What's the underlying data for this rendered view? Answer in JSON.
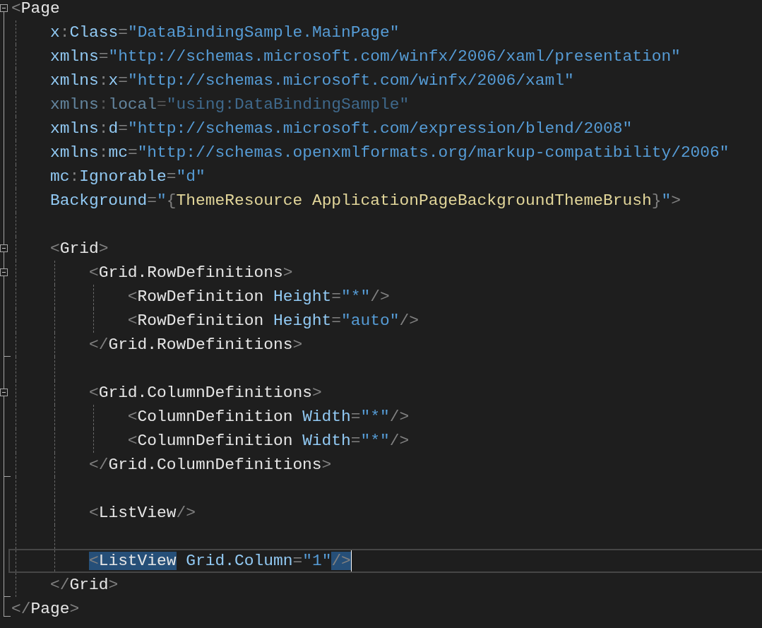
{
  "editor": {
    "lines": [
      {
        "collapsible": true,
        "block_end": false,
        "tokens": [
          {
            "kind": "punct",
            "text": "<"
          },
          {
            "kind": "element",
            "text": "Page"
          }
        ]
      },
      {
        "collapsible": false,
        "block_end": false,
        "tokens": [
          {
            "kind": "attr",
            "text": "    x"
          },
          {
            "kind": "punct",
            "text": ":"
          },
          {
            "kind": "attr",
            "text": "Class"
          },
          {
            "kind": "punct",
            "text": "="
          },
          {
            "kind": "value",
            "text": "\"DataBindingSample.MainPage\""
          }
        ]
      },
      {
        "collapsible": false,
        "block_end": false,
        "tokens": [
          {
            "kind": "attr",
            "text": "    xmlns"
          },
          {
            "kind": "punct",
            "text": "="
          },
          {
            "kind": "value",
            "text": "\"http://schemas.microsoft.com/winfx/2006/xaml/presentation\""
          }
        ]
      },
      {
        "collapsible": false,
        "block_end": false,
        "tokens": [
          {
            "kind": "attr",
            "text": "    xmlns"
          },
          {
            "kind": "punct",
            "text": ":"
          },
          {
            "kind": "attr",
            "text": "x"
          },
          {
            "kind": "punct",
            "text": "="
          },
          {
            "kind": "value",
            "text": "\"http://schemas.microsoft.com/winfx/2006/xaml\""
          }
        ]
      },
      {
        "collapsible": false,
        "block_end": false,
        "dimmed": true,
        "tokens": [
          {
            "kind": "attr",
            "text": "    xmlns"
          },
          {
            "kind": "punct",
            "text": ":"
          },
          {
            "kind": "attr",
            "text": "local"
          },
          {
            "kind": "punct",
            "text": "="
          },
          {
            "kind": "value",
            "text": "\"using:DataBindingSample\""
          }
        ]
      },
      {
        "collapsible": false,
        "block_end": false,
        "tokens": [
          {
            "kind": "attr",
            "text": "    xmlns"
          },
          {
            "kind": "punct",
            "text": ":"
          },
          {
            "kind": "attr",
            "text": "d"
          },
          {
            "kind": "punct",
            "text": "="
          },
          {
            "kind": "value",
            "text": "\"http://schemas.microsoft.com/expression/blend/2008\""
          }
        ]
      },
      {
        "collapsible": false,
        "block_end": false,
        "tokens": [
          {
            "kind": "attr",
            "text": "    xmlns"
          },
          {
            "kind": "punct",
            "text": ":"
          },
          {
            "kind": "attr",
            "text": "mc"
          },
          {
            "kind": "punct",
            "text": "="
          },
          {
            "kind": "value",
            "text": "\"http://schemas.openxmlformats.org/markup-compatibility/2006\""
          }
        ]
      },
      {
        "collapsible": false,
        "block_end": false,
        "tokens": [
          {
            "kind": "attr",
            "text": "    mc"
          },
          {
            "kind": "punct",
            "text": ":"
          },
          {
            "kind": "attr",
            "text": "Ignorable"
          },
          {
            "kind": "punct",
            "text": "="
          },
          {
            "kind": "value",
            "text": "\"d\""
          }
        ]
      },
      {
        "collapsible": false,
        "block_end": false,
        "tokens": [
          {
            "kind": "attr",
            "text": "    Background"
          },
          {
            "kind": "punct",
            "text": "="
          },
          {
            "kind": "value",
            "text": "\""
          },
          {
            "kind": "punct",
            "text": "{"
          },
          {
            "kind": "markup",
            "text": "ThemeResource ApplicationPageBackgroundThemeBrush"
          },
          {
            "kind": "punct",
            "text": "}"
          },
          {
            "kind": "value",
            "text": "\""
          },
          {
            "kind": "punct",
            "text": ">"
          }
        ]
      },
      {
        "collapsible": false,
        "block_end": false
      },
      {
        "collapsible": true,
        "block_end": false,
        "tokens": [
          {
            "kind": "punct",
            "text": "    <"
          },
          {
            "kind": "element",
            "text": "Grid"
          },
          {
            "kind": "punct",
            "text": ">"
          }
        ]
      },
      {
        "collapsible": true,
        "block_end": false,
        "tokens": [
          {
            "kind": "punct",
            "text": "        <"
          },
          {
            "kind": "element",
            "text": "Grid.RowDefinitions"
          },
          {
            "kind": "punct",
            "text": ">"
          }
        ]
      },
      {
        "collapsible": false,
        "block_end": false,
        "tokens": [
          {
            "kind": "punct",
            "text": "            <"
          },
          {
            "kind": "element",
            "text": "RowDefinition"
          },
          {
            "kind": "attr",
            "text": " Height"
          },
          {
            "kind": "punct",
            "text": "="
          },
          {
            "kind": "value",
            "text": "\"*\""
          },
          {
            "kind": "punct",
            "text": "/>"
          }
        ]
      },
      {
        "collapsible": false,
        "block_end": false,
        "tokens": [
          {
            "kind": "punct",
            "text": "            <"
          },
          {
            "kind": "element",
            "text": "RowDefinition"
          },
          {
            "kind": "attr",
            "text": " Height"
          },
          {
            "kind": "punct",
            "text": "="
          },
          {
            "kind": "value",
            "text": "\"auto\""
          },
          {
            "kind": "punct",
            "text": "/>"
          }
        ]
      },
      {
        "collapsible": false,
        "block_end": true,
        "tokens": [
          {
            "kind": "punct",
            "text": "        </"
          },
          {
            "kind": "element",
            "text": "Grid.RowDefinitions"
          },
          {
            "kind": "punct",
            "text": ">"
          }
        ]
      },
      {
        "collapsible": false,
        "block_end": false
      },
      {
        "collapsible": true,
        "block_end": false,
        "tokens": [
          {
            "kind": "punct",
            "text": "        <"
          },
          {
            "kind": "element",
            "text": "Grid.ColumnDefinitions"
          },
          {
            "kind": "punct",
            "text": ">"
          }
        ]
      },
      {
        "collapsible": false,
        "block_end": false,
        "tokens": [
          {
            "kind": "punct",
            "text": "            <"
          },
          {
            "kind": "element",
            "text": "ColumnDefinition"
          },
          {
            "kind": "attr",
            "text": " Width"
          },
          {
            "kind": "punct",
            "text": "="
          },
          {
            "kind": "value",
            "text": "\"*\""
          },
          {
            "kind": "punct",
            "text": "/>"
          }
        ]
      },
      {
        "collapsible": false,
        "block_end": false,
        "tokens": [
          {
            "kind": "punct",
            "text": "            <"
          },
          {
            "kind": "element",
            "text": "ColumnDefinition"
          },
          {
            "kind": "attr",
            "text": " Width"
          },
          {
            "kind": "punct",
            "text": "="
          },
          {
            "kind": "value",
            "text": "\"*\""
          },
          {
            "kind": "punct",
            "text": "/>"
          }
        ]
      },
      {
        "collapsible": false,
        "block_end": true,
        "tokens": [
          {
            "kind": "punct",
            "text": "        </"
          },
          {
            "kind": "element",
            "text": "Grid.ColumnDefinitions"
          },
          {
            "kind": "punct",
            "text": ">"
          }
        ]
      },
      {
        "collapsible": false,
        "block_end": false
      },
      {
        "collapsible": false,
        "block_end": false,
        "tokens": [
          {
            "kind": "punct",
            "text": "        <"
          },
          {
            "kind": "element",
            "text": "ListView"
          },
          {
            "kind": "punct",
            "text": "/>"
          }
        ]
      },
      {
        "collapsible": false,
        "block_end": false
      },
      {
        "collapsible": false,
        "block_end": false,
        "current": true,
        "tokens": [
          {
            "kind": "punct",
            "text": "        <",
            "selected": true
          },
          {
            "kind": "element",
            "text": "ListView",
            "selected": true
          },
          {
            "kind": "attr",
            "text": " Grid.Column",
            "selected": false
          },
          {
            "kind": "punct",
            "text": "=",
            "selected": false
          },
          {
            "kind": "value",
            "text": "\"1\"",
            "selected": false
          },
          {
            "kind": "punct",
            "text": "/>",
            "selected": true
          }
        ]
      },
      {
        "collapsible": false,
        "block_end": true,
        "tokens": [
          {
            "kind": "punct",
            "text": "    </"
          },
          {
            "kind": "element",
            "text": "Grid"
          },
          {
            "kind": "punct",
            "text": ">"
          }
        ]
      },
      {
        "collapsible": false,
        "block_end": true,
        "tokens": [
          {
            "kind": "punct",
            "text": "</"
          },
          {
            "kind": "element",
            "text": "Page"
          },
          {
            "kind": "punct",
            "text": ">"
          }
        ]
      }
    ]
  }
}
